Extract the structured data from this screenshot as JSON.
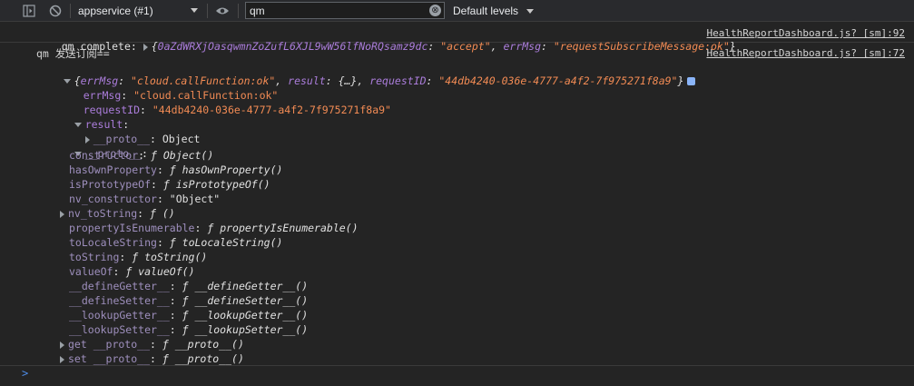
{
  "toolbar": {
    "context": "appservice (#1)",
    "filter_value": "qm",
    "clear_glyph": "⊗",
    "levels_label": "Default levels"
  },
  "messages": [
    {
      "prefix": "qm complete: ",
      "body_open": "{",
      "body_key": "0aZdWRXjOasqwmnZoZufL6XJL9wW56lfNoRQsamz9dc",
      "body_val": "\"accept\"",
      "body_key2": "errMsg",
      "body_val2": "\"requestSubscribeMessage:ok\"",
      "body_close": "}",
      "source": "HealthReportDashboard.js? [sm]:92"
    },
    {
      "prefix": "qm 发送订阅==",
      "source": "HealthReportDashboard.js? [sm]:72"
    }
  ],
  "object_summary": {
    "k1": "errMsg",
    "v1": "\"cloud.callFunction:ok\"",
    "k2": "result",
    "v2": "{…}",
    "k3": "requestID",
    "v3": "\"44db4240-036e-4777-a4f2-7f975271f8a9\""
  },
  "tree": {
    "errMsg_key": "errMsg",
    "errMsg_val": "\"cloud.callFunction:ok\"",
    "requestID_key": "requestID",
    "requestID_val": "\"44db4240-036e-4777-a4f2-7f975271f8a9\"",
    "result_key": "result",
    "result_proto_key": "__proto__",
    "result_proto_val": "Object",
    "proto_key": "__proto__",
    "proto_items": [
      {
        "key": "constructor",
        "val": "ƒ Object()"
      },
      {
        "key": "hasOwnProperty",
        "val": "ƒ hasOwnProperty()"
      },
      {
        "key": "isPrototypeOf",
        "val": "ƒ isPrototypeOf()"
      },
      {
        "key": "nv_constructor",
        "val": "\"Object\""
      },
      {
        "key": "nv_toString",
        "val": "ƒ ()"
      },
      {
        "key": "propertyIsEnumerable",
        "val": "ƒ propertyIsEnumerable()"
      },
      {
        "key": "toLocaleString",
        "val": "ƒ toLocaleString()"
      },
      {
        "key": "toString",
        "val": "ƒ toString()"
      },
      {
        "key": "valueOf",
        "val": "ƒ valueOf()"
      },
      {
        "key": "__defineGetter__",
        "val": "ƒ __defineGetter__()"
      },
      {
        "key": "__defineSetter__",
        "val": "ƒ __defineSetter__()"
      },
      {
        "key": "__lookupGetter__",
        "val": "ƒ __lookupGetter__()"
      },
      {
        "key": "__lookupSetter__",
        "val": "ƒ __lookupSetter__()"
      },
      {
        "key": "get __proto__",
        "val": "ƒ __proto__()"
      },
      {
        "key": "set __proto__",
        "val": "ƒ __proto__()"
      }
    ]
  },
  "prompt_glyph": ">"
}
